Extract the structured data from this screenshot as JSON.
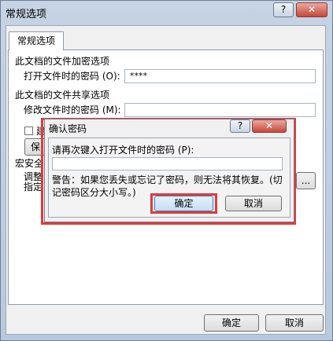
{
  "window": {
    "title": "常规选项",
    "help_glyph": "?",
    "close_glyph": "✕"
  },
  "tab": {
    "label": "常规选项"
  },
  "encrypt": {
    "heading": "此文档的文件加密选项",
    "open_pw_label": "打开文件时的密码 (O):",
    "open_pw_value": "****"
  },
  "share": {
    "heading": "此文档的文件共享选项",
    "modify_pw_label": "修改文件时的密码 (M):"
  },
  "hidden_partial": {
    "checkbox_label": "建",
    "button_label": "保",
    "macro_heading": "宏安全",
    "macro_line1": "调整",
    "macro_line2": "指定"
  },
  "footer": {
    "ok_label": "确定",
    "cancel_label": "取消"
  },
  "confirm_dialog": {
    "title": "确认密码",
    "help_glyph": "?",
    "close_glyph": "✕",
    "prompt": "请再次键入打开文件时的密码 (P):",
    "warning": "警告：如果您丢失或忘记了密码，则无法将其恢复。(切记密码区分大小写。)",
    "ok_label": "确定",
    "cancel_label": "取消"
  }
}
